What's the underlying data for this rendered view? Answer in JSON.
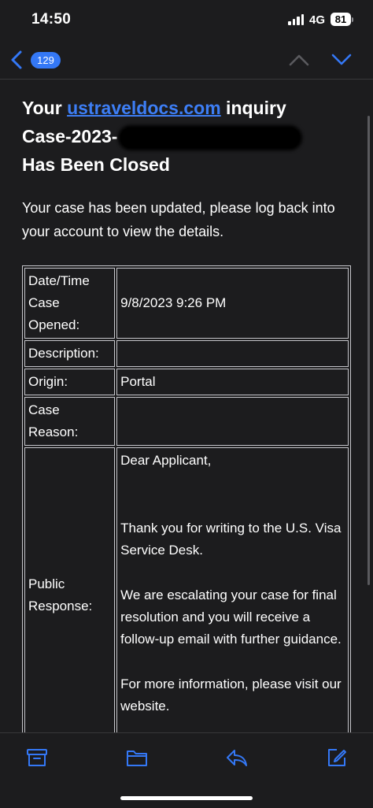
{
  "status_bar": {
    "time": "14:50",
    "network": "4G",
    "battery": "81"
  },
  "nav": {
    "unread_count": "129"
  },
  "email": {
    "subject_prefix": "Your ",
    "subject_link": "ustraveldocs.com",
    "subject_after_link": " inquiry",
    "subject_case": "Case-2023-",
    "subject_end": "Has Been Closed",
    "intro": "Your case has been updated, please log back into your account to view the details."
  },
  "table": {
    "rows": [
      {
        "label": "Date/Time Case Opened:",
        "value": "9/8/2023 9:26 PM"
      },
      {
        "label": "Description:",
        "value": ""
      },
      {
        "label": "Origin:",
        "value": "Portal"
      },
      {
        "label": "Case Reason:",
        "value": ""
      }
    ],
    "response_label": "Public Response:",
    "response_paragraphs": [
      "Dear Applicant,",
      "Thank you for writing to the U.S. Visa Service Desk.",
      "We are escalating your case for final resolution and you will receive a follow-up email with further guidance.",
      "For more information, please visit our website."
    ]
  },
  "colors": {
    "background": "#1c1c1e",
    "accent": "#3478f6",
    "link": "#3d7ef5"
  },
  "toolbar": {
    "icons": [
      "archive-icon",
      "folder-icon",
      "reply-icon",
      "compose-icon"
    ]
  }
}
